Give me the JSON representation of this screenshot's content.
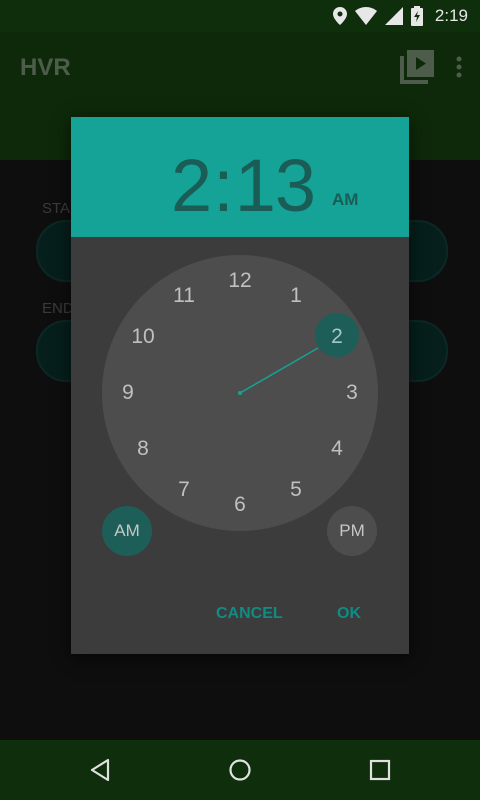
{
  "status_bar": {
    "time": "2:19"
  },
  "app": {
    "title": "HVR"
  },
  "background": {
    "start_label": "STA",
    "end_label": "END"
  },
  "dialog": {
    "hour": "2",
    "minute": "13",
    "ampm": "AM",
    "clock_numbers": [
      "12",
      "1",
      "2",
      "3",
      "4",
      "5",
      "6",
      "7",
      "8",
      "9",
      "10",
      "11"
    ],
    "selected_number": "2",
    "am_label": "AM",
    "pm_label": "PM",
    "cancel_label": "CANCEL",
    "ok_label": "OK"
  },
  "colors": {
    "accent": "#14a396",
    "app_bar": "#184c12",
    "status_bar": "#0f2e0c"
  }
}
